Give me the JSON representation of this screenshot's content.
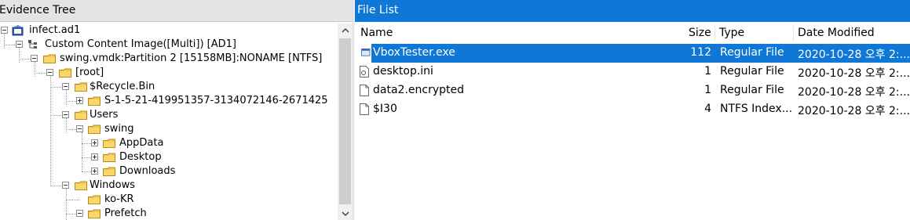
{
  "left_panel": {
    "title": "Evidence Tree",
    "tree": [
      {
        "label": "infect.ad1",
        "icon": "evidence-icon",
        "expanded": true
      },
      {
        "label": "Custom Content Image([Multi]) [AD1]",
        "icon": "image-tree-icon",
        "expanded": true
      },
      {
        "label": "swing.vmdk:Partition 2 [15158MB]:NONAME [NTFS]",
        "icon": "folder-icon",
        "expanded": true
      },
      {
        "label": "[root]",
        "icon": "folder-icon",
        "expanded": true
      },
      {
        "label": "$Recycle.Bin",
        "icon": "folder-icon",
        "expanded": true
      },
      {
        "label": "S-1-5-21-419951357-3134072146-2671425",
        "icon": "folder-icon",
        "expanded": false
      },
      {
        "label": "Users",
        "icon": "folder-icon",
        "expanded": true
      },
      {
        "label": "swing",
        "icon": "folder-icon",
        "expanded": true
      },
      {
        "label": "AppData",
        "icon": "folder-icon",
        "expanded": false
      },
      {
        "label": "Desktop",
        "icon": "folder-icon",
        "expanded": false
      },
      {
        "label": "Downloads",
        "icon": "folder-icon",
        "expanded": false
      },
      {
        "label": "Windows",
        "icon": "folder-icon",
        "expanded": true
      },
      {
        "label": "ko-KR",
        "icon": "folder-icon",
        "expanded": null
      },
      {
        "label": "Prefetch",
        "icon": "folder-icon",
        "expanded": true
      }
    ],
    "scroll_up": "^",
    "scroll_down": "v"
  },
  "right_panel": {
    "title": "File List",
    "columns": {
      "name": "Name",
      "size": "Size",
      "type": "Type",
      "date": "Date Modified"
    },
    "files": [
      {
        "name": "VboxTester.exe",
        "size": "112",
        "type": "Regular File",
        "date": "2020-10-28 오후 2:...",
        "icon": "exe-icon",
        "selected": true
      },
      {
        "name": "desktop.ini",
        "size": "1",
        "type": "Regular File",
        "date": "2020-10-28 오후 2:...",
        "icon": "settings-file-icon",
        "selected": false
      },
      {
        "name": "data2.encrypted",
        "size": "1",
        "type": "Regular File",
        "date": "2020-10-28 오후 2:...",
        "icon": "file-icon",
        "selected": false
      },
      {
        "name": "$I30",
        "size": "4",
        "type": "NTFS Index...",
        "date": "2020-10-28 오후 2:...",
        "icon": "file-icon",
        "selected": false
      }
    ]
  },
  "colors": {
    "accent": "#0f78d7",
    "folder": "#f3c94e",
    "header_bg": "#e4e4e4"
  }
}
